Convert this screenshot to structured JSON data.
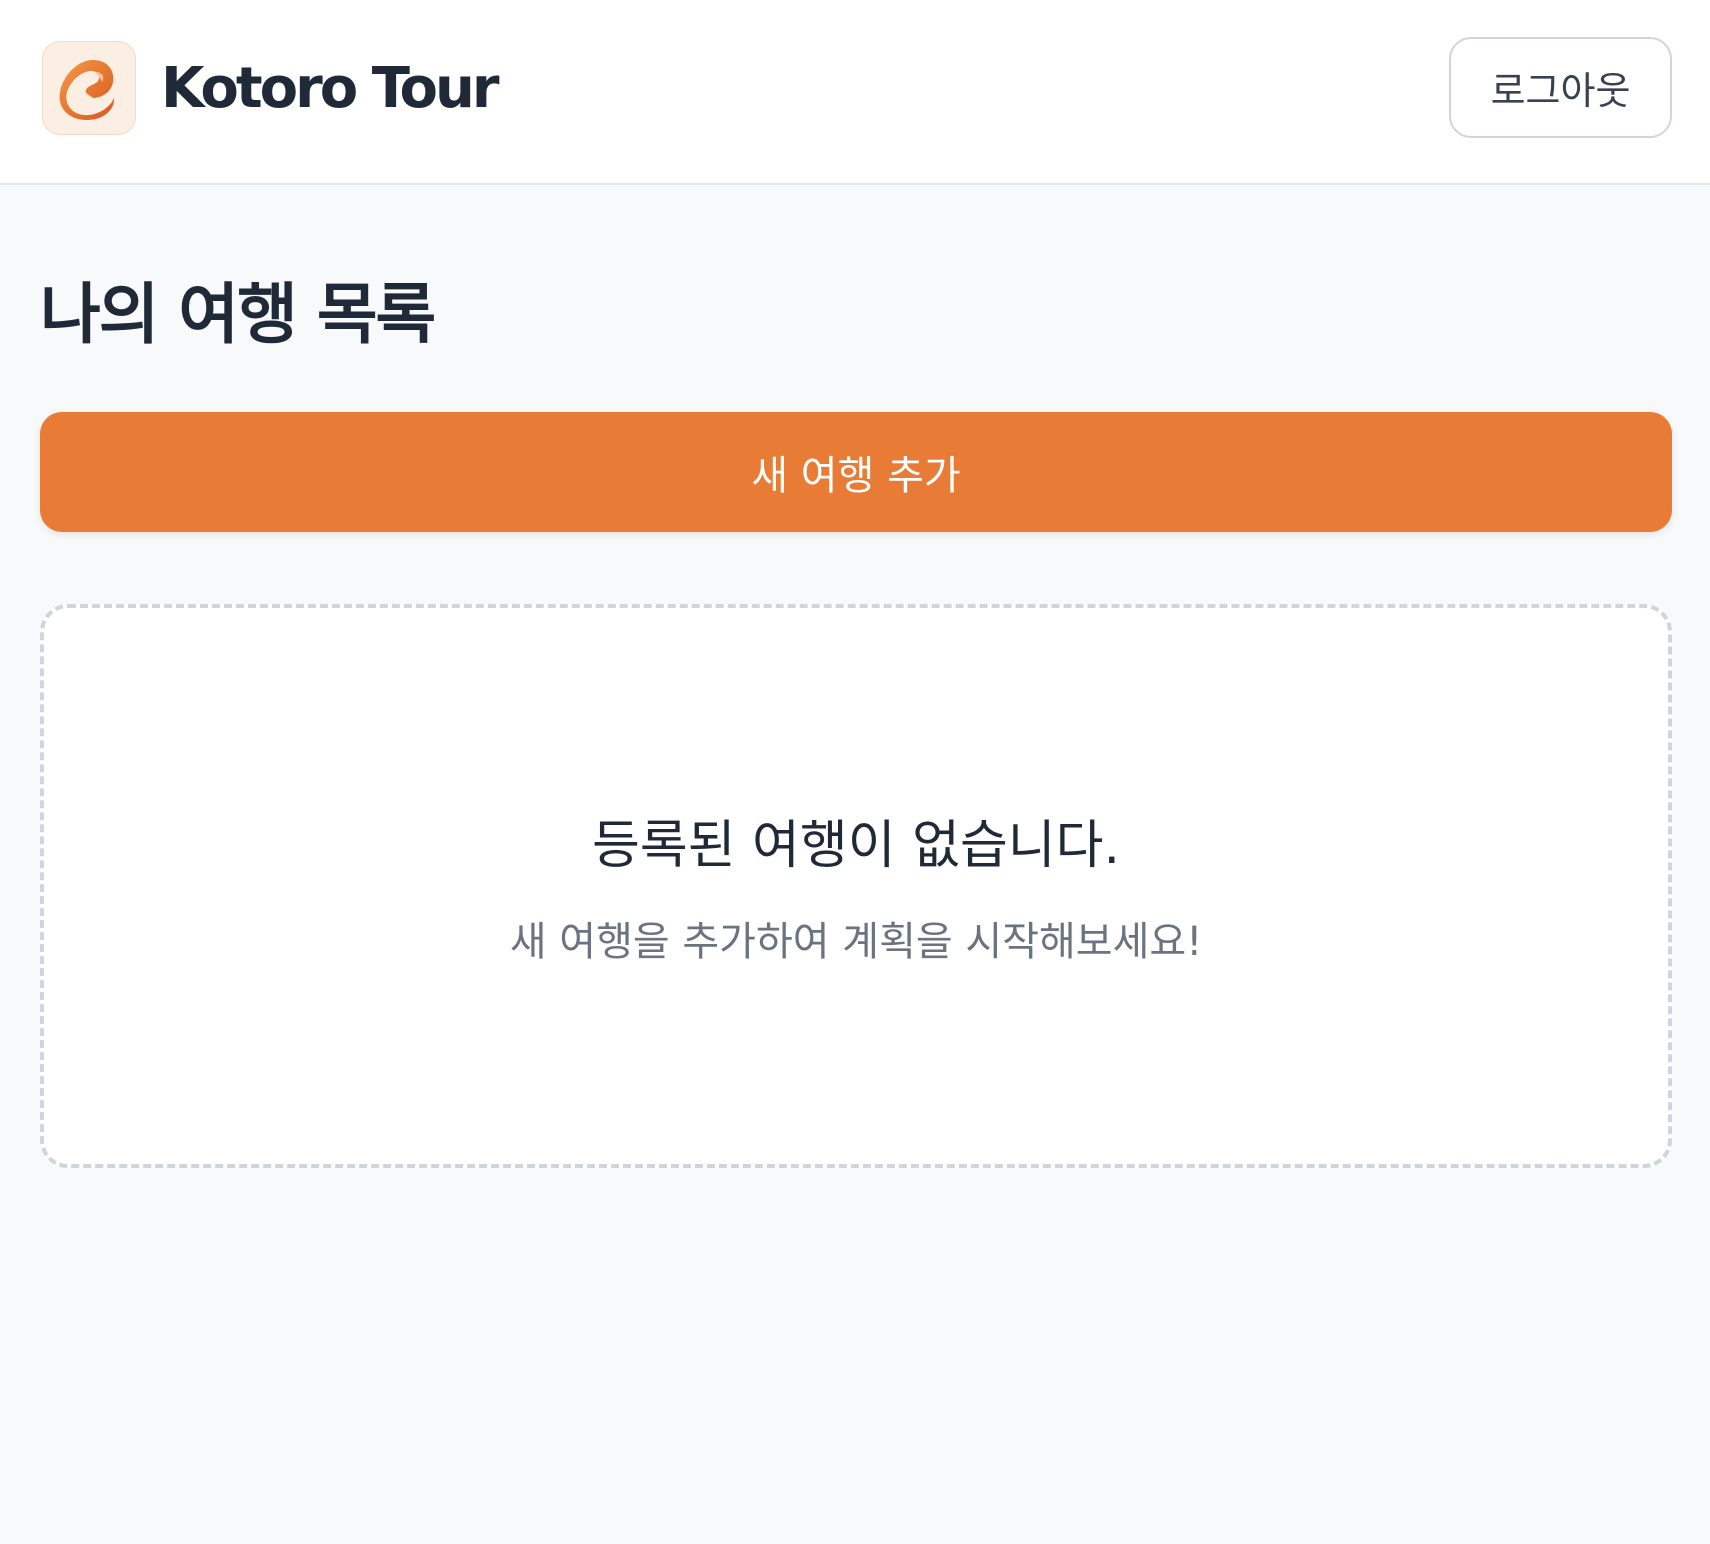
{
  "header": {
    "brand_name": "Kotoro Tour",
    "logo_icon": "kotoro-tour-logo-icon",
    "logout_label": "로그아웃"
  },
  "main": {
    "title": "나의 여행 목록",
    "add_trip_label": "새 여행 추가",
    "empty_state": {
      "title": "등록된 여행이 없습니다.",
      "subtitle": "새 여행을 추가하여 계획을 시작해보세요!"
    }
  },
  "colors": {
    "accent": "#e87b36",
    "page_background": "#f8f9fa",
    "text_primary": "#1f2937",
    "text_secondary": "#6b7280",
    "border": "#d1d5db"
  }
}
